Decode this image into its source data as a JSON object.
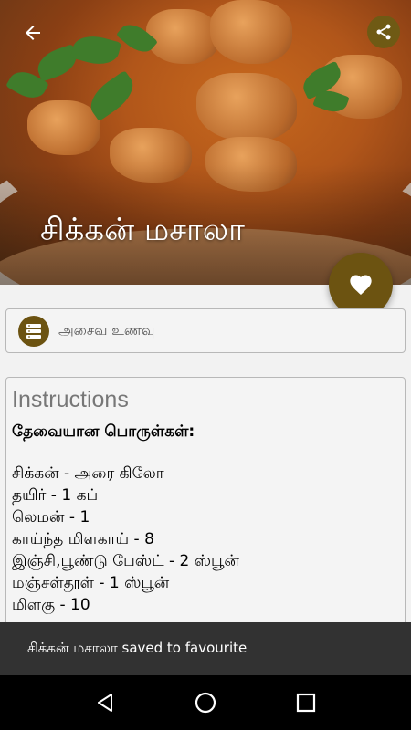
{
  "recipe": {
    "title": "சிக்கன் மசாலா",
    "category": "அசைவ உணவு"
  },
  "instructions": {
    "heading": "Instructions",
    "ingredients_heading": "தேவையான பொருள்கள்:",
    "ingredients": [
      "சிக்கன் - அரை கிலோ",
      "தயிர் - 1 கப்",
      "லெமன் - 1",
      "காய்ந்த மிளகாய் - 8",
      "இஞ்சி,பூண்டு பேஸ்ட் - 2 ஸ்பூன்",
      "மஞ்சள்தூள் - 1 ஸ்பூன்",
      "மிளகு - 10"
    ]
  },
  "snackbar": {
    "message": "சிக்கன் மசாலா  saved to favourite"
  },
  "icons": {
    "back": "arrow-back-icon",
    "share": "share-icon",
    "favourite": "heart-icon",
    "category": "list-icon",
    "nav_back": "triangle-back-icon",
    "nav_home": "circle-home-icon",
    "nav_recents": "square-recents-icon"
  },
  "colors": {
    "accent": "#6c5311",
    "snackbar": "#323232",
    "nav_bar": "#000000"
  }
}
